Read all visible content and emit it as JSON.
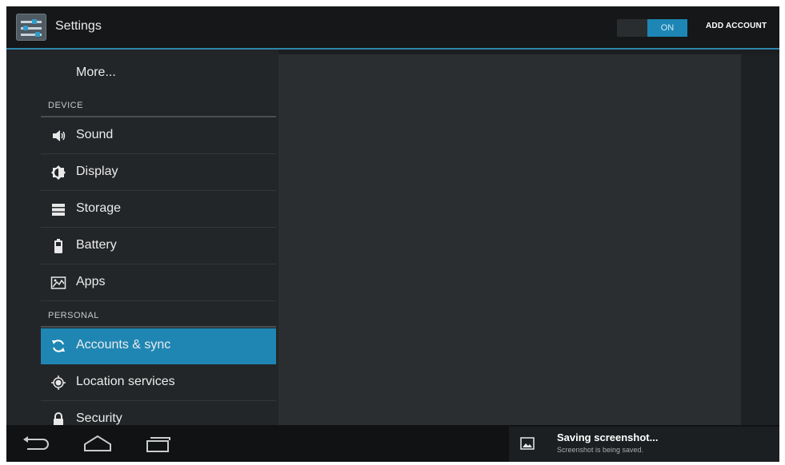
{
  "actionbar": {
    "title": "Settings",
    "toggle_label": "ON",
    "add_account_label": "ADD ACCOUNT"
  },
  "sidebar": {
    "more_label": "More...",
    "sections": [
      {
        "header": "DEVICE",
        "items": [
          {
            "label": "Sound",
            "icon": "speaker-icon"
          },
          {
            "label": "Display",
            "icon": "brightness-icon"
          },
          {
            "label": "Storage",
            "icon": "storage-icon"
          },
          {
            "label": "Battery",
            "icon": "battery-icon"
          },
          {
            "label": "Apps",
            "icon": "apps-icon"
          }
        ]
      },
      {
        "header": "PERSONAL",
        "items": [
          {
            "label": "Accounts & sync",
            "icon": "sync-icon",
            "selected": true
          },
          {
            "label": "Location services",
            "icon": "location-icon"
          },
          {
            "label": "Security",
            "icon": "lock-icon"
          }
        ]
      }
    ]
  },
  "notification": {
    "title": "Saving screenshot...",
    "subtitle": "Screenshot is being saved."
  },
  "colors": {
    "accent": "#1f86b3",
    "background": "#1b1e20",
    "panel": "#2b2e31"
  }
}
